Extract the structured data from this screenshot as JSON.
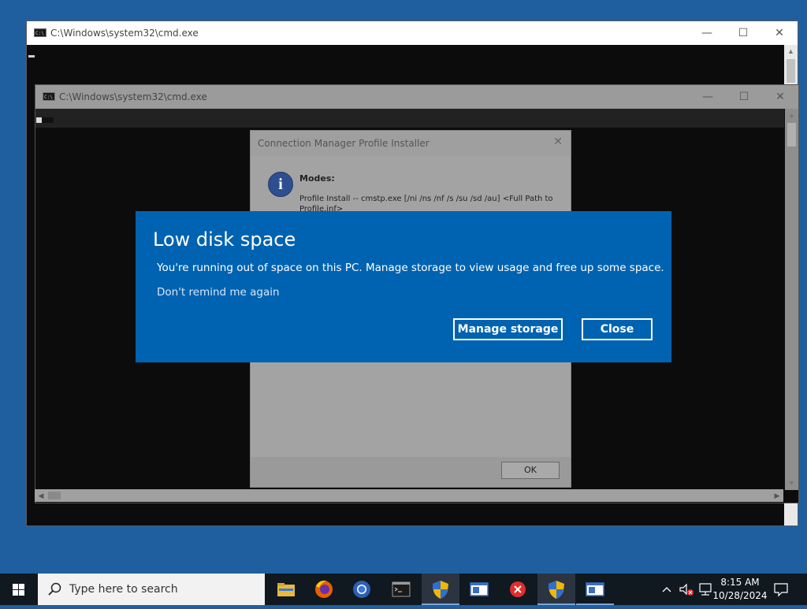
{
  "desktop": {
    "background": "#1f5fa0"
  },
  "cmd_window_1": {
    "title": "C:\\Windows\\system32\\cmd.exe",
    "minimize": "—",
    "maximize": "☐",
    "close": "✕"
  },
  "cmd_window_2": {
    "title": "C:\\Windows\\system32\\cmd.exe",
    "minimize": "—",
    "maximize": "☐",
    "close": "✕"
  },
  "profile_installer": {
    "title": "Connection Manager Profile Installer",
    "close": "✕",
    "modes_label": "Modes:",
    "mode_text": "Profile Install -- cmstp.exe [/ni /ns /nf /s /su /sd /au] <Full Path to Profile.inf>",
    "ok_label": "OK"
  },
  "toast": {
    "title": "Low disk space",
    "message": "You're running out of space on this PC. Manage storage to view usage and free up some space.",
    "link": "Don't remind me again",
    "manage_label": "Manage storage",
    "close_label": "Close",
    "background": "#0063b1"
  },
  "taskbar": {
    "search_placeholder": "Type here to search",
    "apps": [
      "file-explorer-icon",
      "firefox-icon",
      "chrome-icon",
      "command-prompt-icon",
      "uac-shield-icon",
      "window-app-icon",
      "error-app-icon",
      "uac-shield-icon",
      "window-app-icon"
    ],
    "time": "8:15 AM",
    "date": "10/28/2024"
  }
}
